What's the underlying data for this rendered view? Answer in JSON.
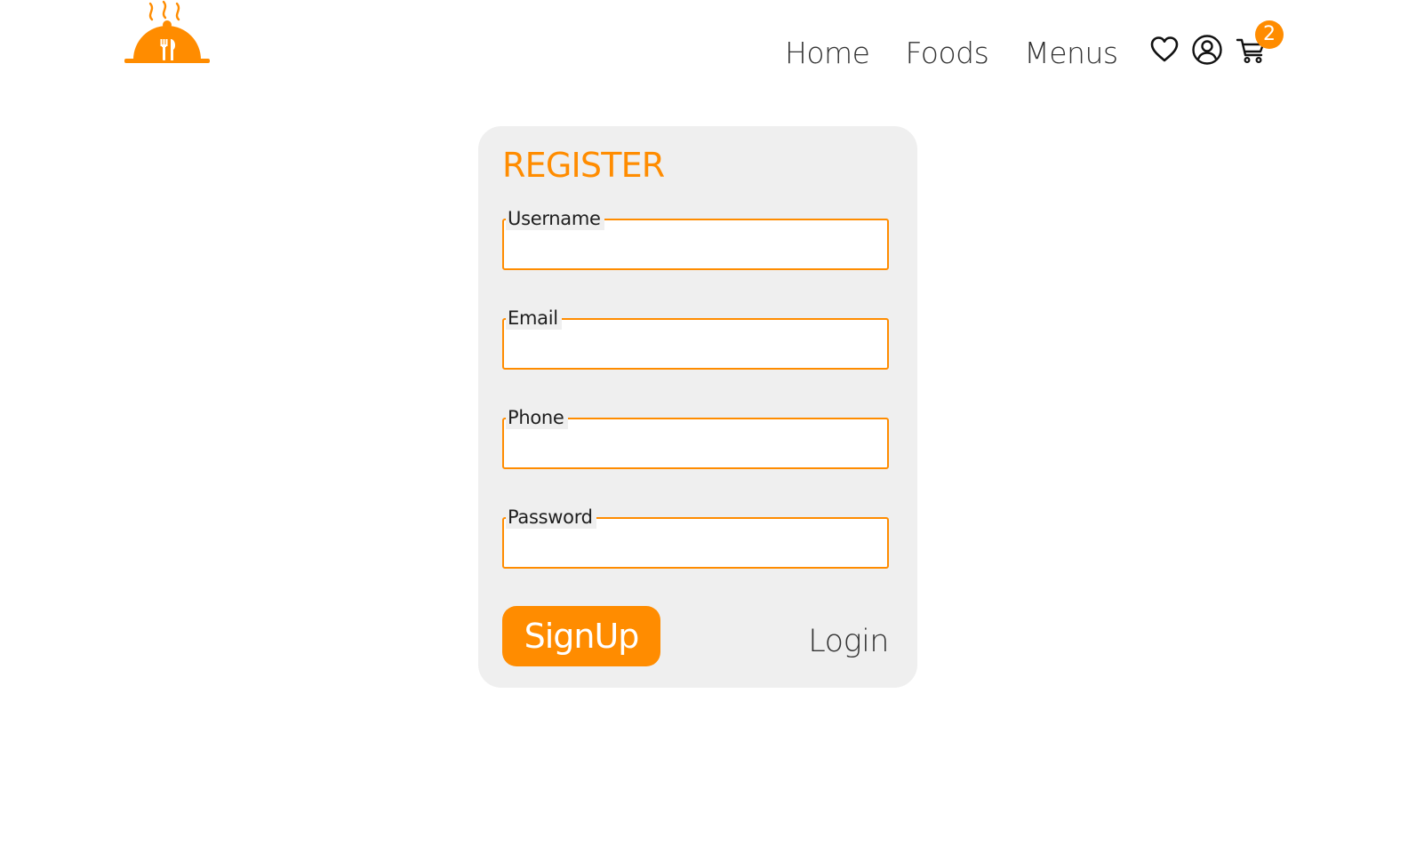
{
  "nav": {
    "items": [
      {
        "label": "Home"
      },
      {
        "label": "Foods"
      },
      {
        "label": "Menus"
      }
    ]
  },
  "icons": {
    "logo": "food-cloche-logo",
    "favorites": "heart-icon",
    "account": "user-circle-icon",
    "cart": "cart-icon"
  },
  "cart": {
    "count": "2"
  },
  "register": {
    "title": "REGISTER",
    "fields": {
      "username": {
        "label": "Username",
        "value": ""
      },
      "email": {
        "label": "Email",
        "value": ""
      },
      "phone": {
        "label": "Phone",
        "value": ""
      },
      "password": {
        "label": "Password",
        "value": ""
      }
    },
    "signup_label": "SignUp",
    "login_label": "Login"
  },
  "colors": {
    "accent": "#ff8c00",
    "card_bg": "#efefef",
    "text": "#333333"
  }
}
